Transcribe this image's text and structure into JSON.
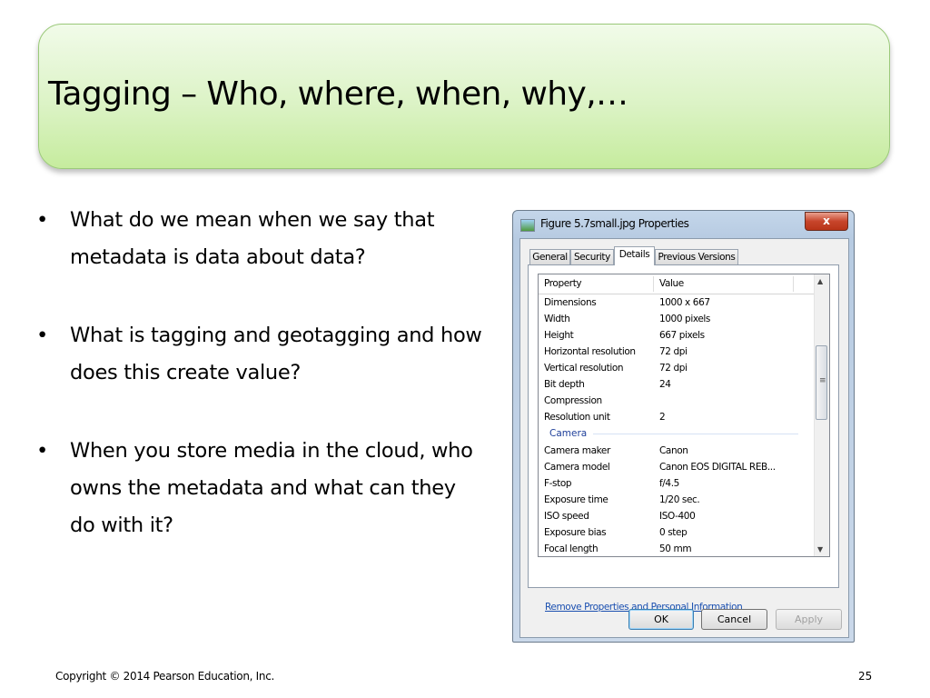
{
  "slide": {
    "title": "Tagging – Who, where, when, why,…",
    "bullets": [
      "What do we mean when we say that metadata is data about data?",
      "What is tagging and geotagging and how does this create value?",
      "When you store media in the cloud, who owns the metadata and what can they do with it?"
    ],
    "bullet_char": "•",
    "copyright": "Copyright © 2014 Pearson Education, Inc.",
    "page_number": "25"
  },
  "dialog": {
    "title": "Figure 5.7small.jpg Properties",
    "close_label": "x",
    "tabs": [
      "General",
      "Security",
      "Details",
      "Previous Versions"
    ],
    "active_tab": "Details",
    "columns": {
      "property": "Property",
      "value": "Value"
    },
    "rows_top": [
      {
        "property": "Dimensions",
        "value": "1000 x 667"
      },
      {
        "property": "Width",
        "value": "1000 pixels"
      },
      {
        "property": "Height",
        "value": "667 pixels"
      },
      {
        "property": "Horizontal resolution",
        "value": "72 dpi"
      },
      {
        "property": "Vertical resolution",
        "value": "72 dpi"
      },
      {
        "property": "Bit depth",
        "value": "24"
      },
      {
        "property": "Compression",
        "value": ""
      },
      {
        "property": "Resolution unit",
        "value": "2"
      }
    ],
    "group_label": "Camera",
    "rows_camera": [
      {
        "property": "Camera maker",
        "value": "Canon"
      },
      {
        "property": "Camera model",
        "value": "Canon EOS DIGITAL REB..."
      },
      {
        "property": "F-stop",
        "value": "f/4.5"
      },
      {
        "property": "Exposure time",
        "value": "1/20 sec."
      },
      {
        "property": "ISO speed",
        "value": "ISO-400"
      },
      {
        "property": "Exposure bias",
        "value": "0 step"
      },
      {
        "property": "Focal length",
        "value": "50 mm"
      }
    ],
    "remove_link": "Remove Properties and Personal Information",
    "buttons": {
      "ok": "OK",
      "cancel": "Cancel",
      "apply": "Apply"
    }
  }
}
